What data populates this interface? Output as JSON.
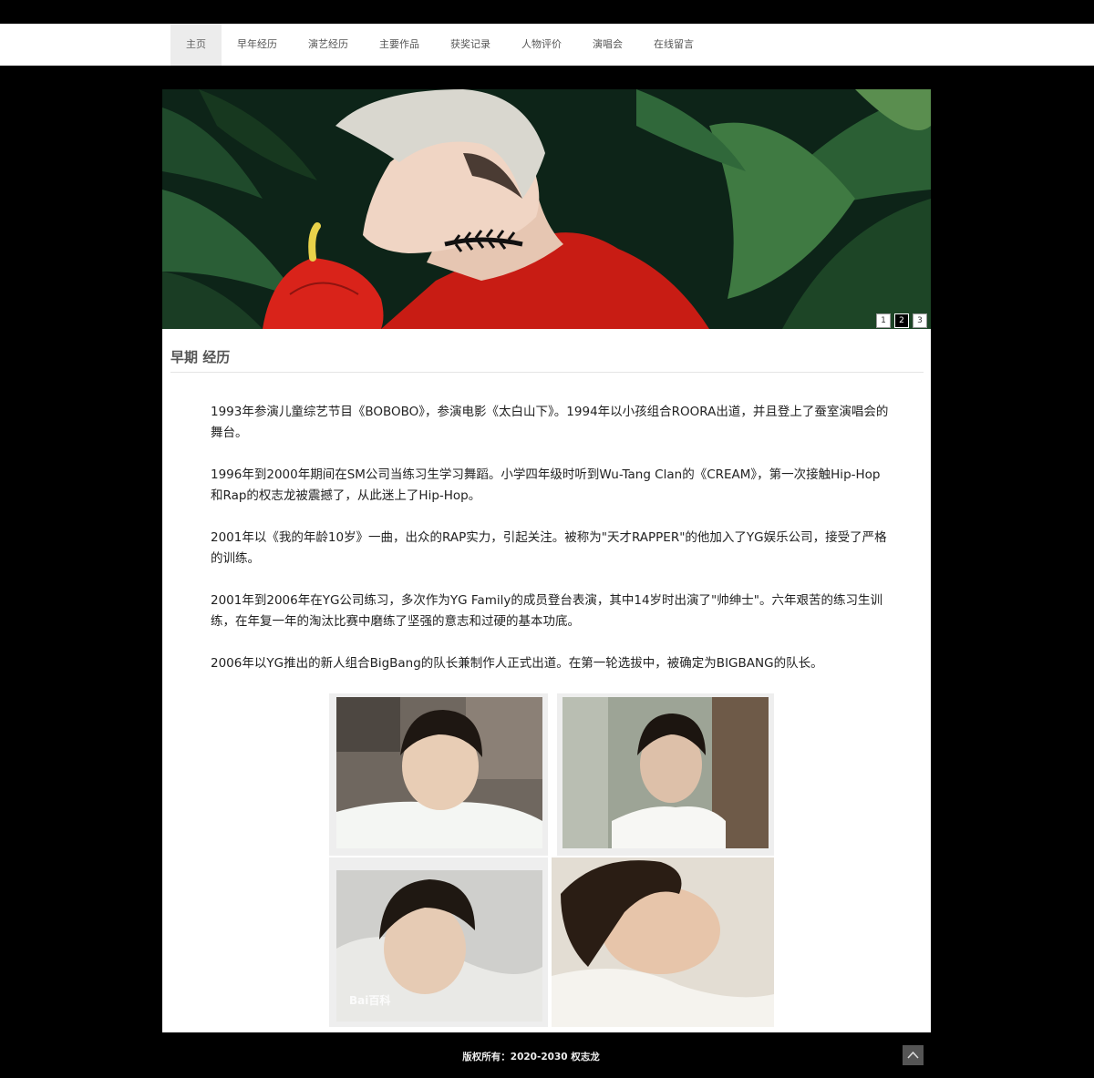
{
  "nav": {
    "items": [
      "主页",
      "早年经历",
      "演艺经历",
      "主要作品",
      "获奖记录",
      "人物评价",
      "演唱会",
      "在线留言"
    ]
  },
  "banner": {
    "dots": [
      "1",
      "2",
      "3"
    ],
    "active_dot": "2"
  },
  "section": {
    "title": "早期 经历",
    "paragraphs": [
      "1993年参演儿童综艺节目《BOBOBO》，参演电影《太白山下》。1994年以小孩组合ROORA出道，并且登上了蚕室演唱会的舞台。",
      "1996年到2000年期间在SM公司当练习生学习舞蹈。小学四年级时听到Wu-Tang Clan的《CREAM》，第一次接触Hip-Hop和Rap的权志龙被震撼了，从此迷上了Hip-Hop。",
      "2001年以《我的年龄10岁》一曲，出众的RAP实力，引起关注。被称为\"天才RAPPER\"的他加入了YG娱乐公司，接受了严格的训练。",
      "2001年到2006年在YG公司练习，多次作为YG Family的成员登台表演，其中14岁时出演了\"帅绅士\"。六年艰苦的练习生训练，在年复一年的淘汰比赛中磨练了坚强的意志和过硬的基本功底。",
      "2006年以YG推出的新人组合BigBang的队长兼制作人正式出道。在第一轮选拔中，被确定为BIGBANG的队长。"
    ],
    "photo_watermark": "Bai百科"
  },
  "footer": {
    "copyright": "版权所有：2020-2030 权志龙"
  }
}
